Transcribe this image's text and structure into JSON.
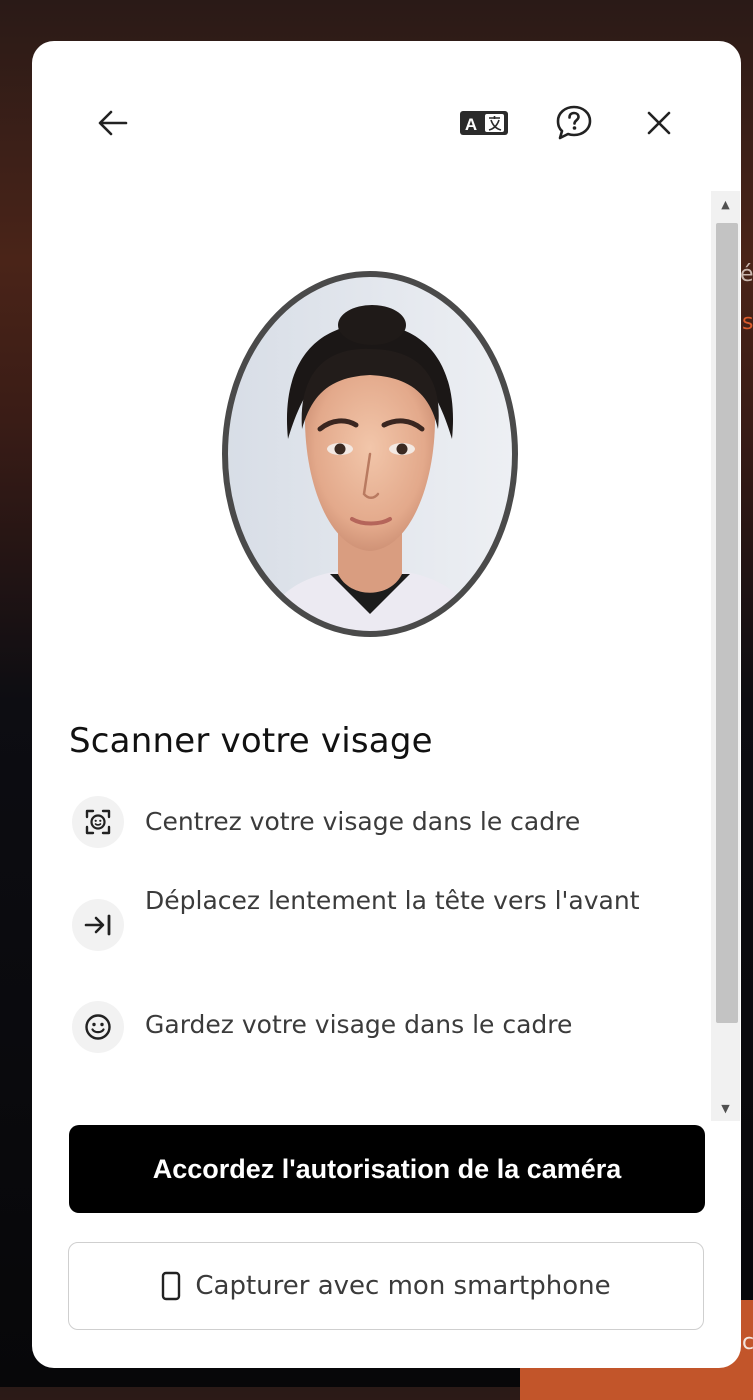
{
  "background": {
    "partial_text_1": "é",
    "partial_text_2": "s",
    "partial_text_3": "c"
  },
  "header": {
    "back_icon": "arrow-left-icon",
    "translate_icon": "translate-icon",
    "help_icon": "help-bubble-icon",
    "close_icon": "close-icon"
  },
  "main": {
    "title": "Scanner votre visage",
    "steps": [
      {
        "icon": "face-scan-icon",
        "text": "Centrez votre visage dans le cadre"
      },
      {
        "icon": "arrow-to-line-icon",
        "text": "Déplacez lentement la tête vers l'avant"
      },
      {
        "icon": "smiley-icon",
        "text": "Gardez votre visage dans le cadre"
      }
    ]
  },
  "actions": {
    "primary_label": "Accordez l'autorisation de la caméra",
    "secondary_label": "Capturer avec mon smartphone",
    "secondary_icon": "smartphone-icon"
  },
  "colors": {
    "primary_button_bg": "#000000",
    "modal_bg": "#ffffff",
    "oval_border": "#4a4a4a"
  }
}
